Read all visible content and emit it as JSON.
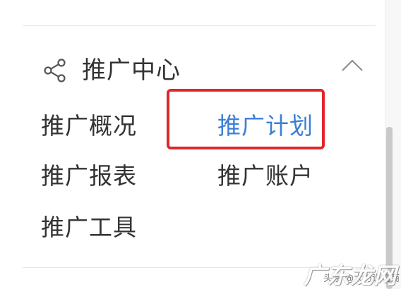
{
  "section": {
    "title": "推广中心",
    "icon": "share-icon",
    "collapse_icon": "chevron-up-icon"
  },
  "menu": {
    "items": [
      {
        "label": "推广概况",
        "active": false
      },
      {
        "label": "推广计划",
        "active": true
      },
      {
        "label": "推广报表",
        "active": false
      },
      {
        "label": "推广账户",
        "active": false
      },
      {
        "label": "推广工具",
        "active": false
      }
    ]
  },
  "highlight": {
    "color": "#e0262b"
  },
  "colors": {
    "text": "#333333",
    "active": "#3a7fd5",
    "divider": "#e6e6e6"
  },
  "watermark": {
    "small": "头条 @大力说电商",
    "large": "广东龙网"
  }
}
